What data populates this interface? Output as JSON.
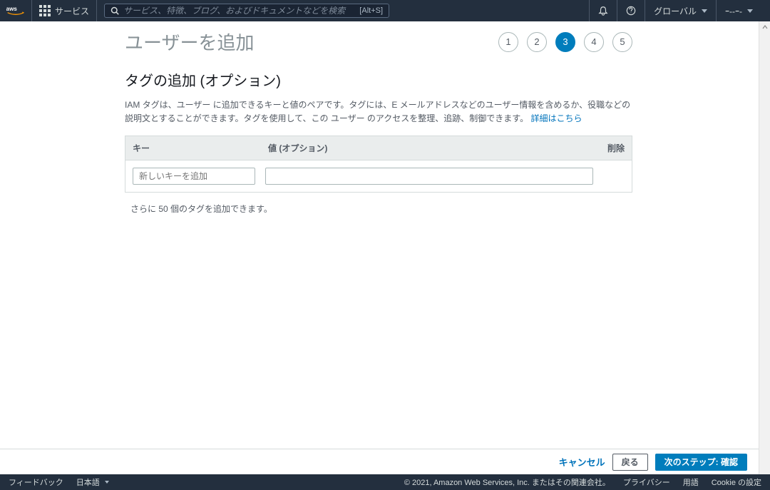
{
  "navbar": {
    "services_label": "サービス",
    "search_placeholder": "サービス、特徴、ブログ、およびドキュメントなどを検索",
    "search_shortcut": "[Alt+S]",
    "region_label": "グローバル",
    "account_label": "ｰ--ｰ-"
  },
  "page": {
    "title": "ユーザーを追加",
    "steps": [
      "1",
      "2",
      "3",
      "4",
      "5"
    ],
    "active_step_index": 2
  },
  "tags": {
    "section_title": "タグの追加 (オプション)",
    "section_desc_1": "IAM タグは、ユーザー に追加できるキーと値のペアです。タグには、E メールアドレスなどのユーザー情報を含めるか、役職などの説明文とすることができます。タグを使用して、この ユーザー のアクセスを整理、追跡、制御できます。 ",
    "learn_more": "詳細はこちら",
    "header_key": "キー",
    "header_value": "値 (オプション)",
    "header_delete": "削除",
    "key_placeholder": "新しいキーを追加",
    "remaining_text": "さらに 50 個のタグを追加できます。"
  },
  "actions": {
    "cancel": "キャンセル",
    "back": "戻る",
    "next": "次のステップ: 確認"
  },
  "footer": {
    "feedback": "フィードバック",
    "language": "日本語",
    "copyright": "© 2021, Amazon Web Services, Inc. またはその関連会社。",
    "privacy": "プライバシー",
    "terms": "用語",
    "cookie": "Cookie の設定"
  }
}
